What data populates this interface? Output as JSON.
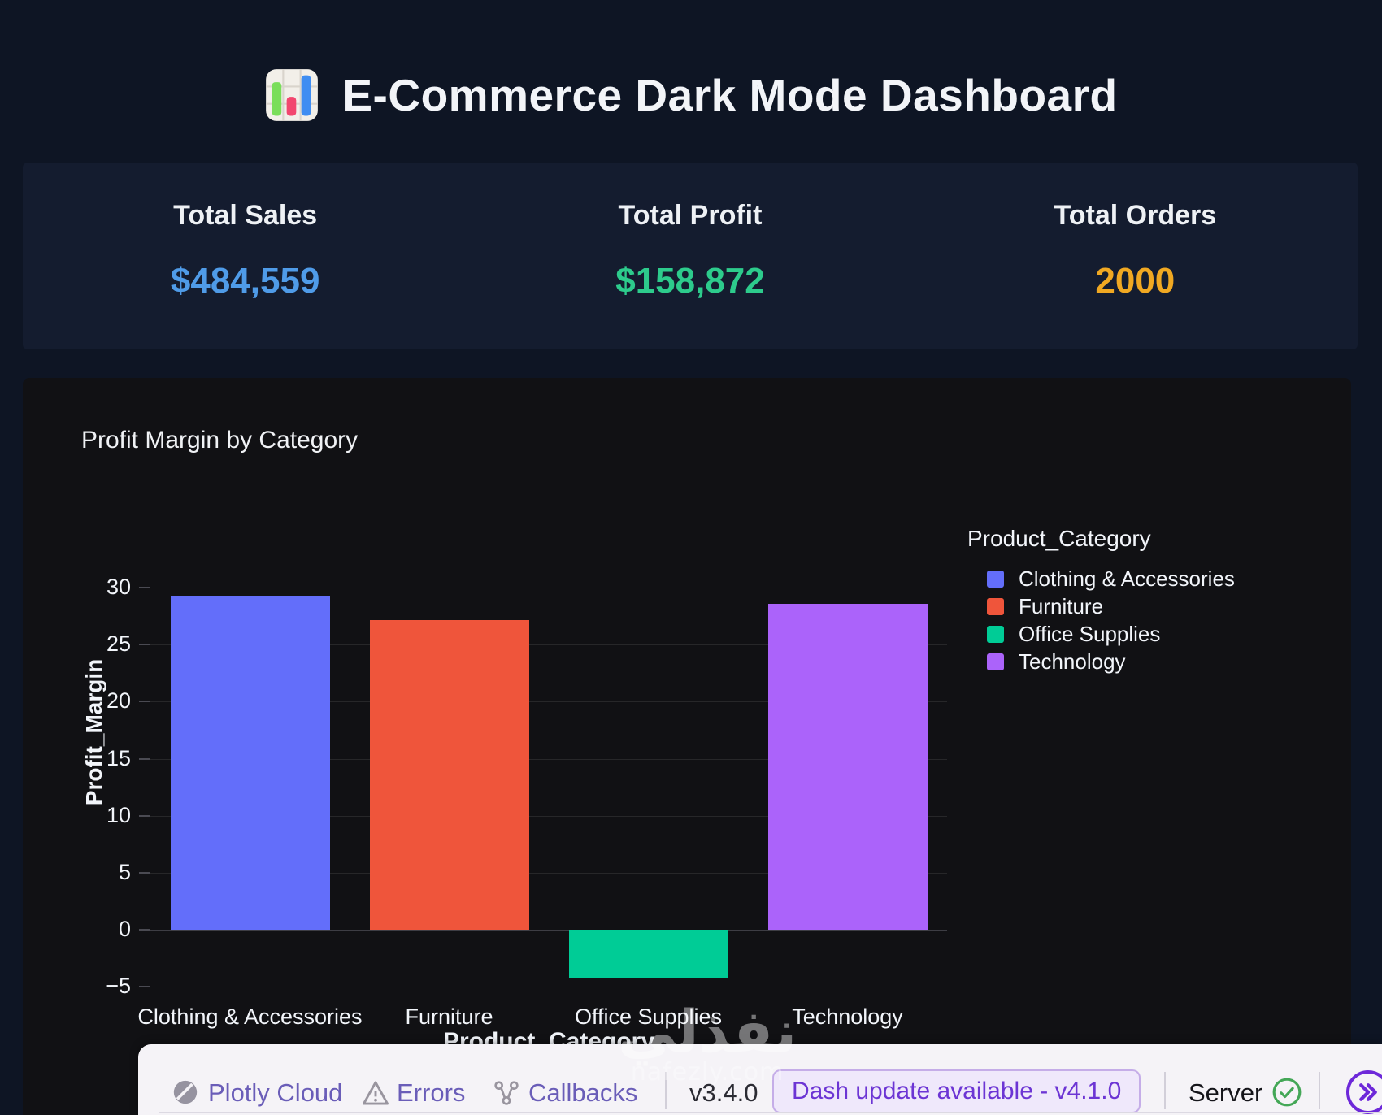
{
  "header": {
    "title": "E-Commerce Dark Mode Dashboard",
    "icon": "bar-chart-emoji-icon"
  },
  "kpis": [
    {
      "label": "Total Sales",
      "value": "$484,559",
      "color": "#4f9be8"
    },
    {
      "label": "Total Profit",
      "value": "$158,872",
      "color": "#2dcb8c"
    },
    {
      "label": "Total Orders",
      "value": "2000",
      "color": "#f0a822"
    }
  ],
  "chart_data": {
    "type": "bar",
    "title": "Profit Margin by Category",
    "categories": [
      "Clothing & Accessories",
      "Furniture",
      "Office Supplies",
      "Technology"
    ],
    "values": [
      29.3,
      27.2,
      -4.2,
      28.6
    ],
    "colors": [
      "#636efa",
      "#ef553b",
      "#00cc96",
      "#ab63fa"
    ],
    "xlabel": "Product_Category",
    "ylabel": "Profit_Margin",
    "yticks": [
      30,
      25,
      20,
      15,
      10,
      5,
      0,
      -5
    ],
    "ylim": [
      -5.3,
      36.8
    ],
    "grid": true,
    "legend_position": "right",
    "legend_title": "Product_Category",
    "legend": [
      "Clothing & Accessories",
      "Furniture",
      "Office Supplies",
      "Technology"
    ]
  },
  "toolbar": {
    "items": [
      {
        "label": "Plotly Cloud",
        "icon": "plotly-logo-icon"
      },
      {
        "label": "Errors",
        "icon": "warning-icon"
      },
      {
        "label": "Callbacks",
        "icon": "callback-graph-icon"
      }
    ],
    "version": "v3.4.0",
    "update_pill": "Dash update available - v4.1.0",
    "server_label": "Server",
    "server_status_icon": "check-circle-icon",
    "expand_icon": "double-chevron-right-icon",
    "accent_color": "#6d28d9"
  },
  "watermark": {
    "arabic": "نفذلي",
    "latin": "nafezly.com"
  }
}
